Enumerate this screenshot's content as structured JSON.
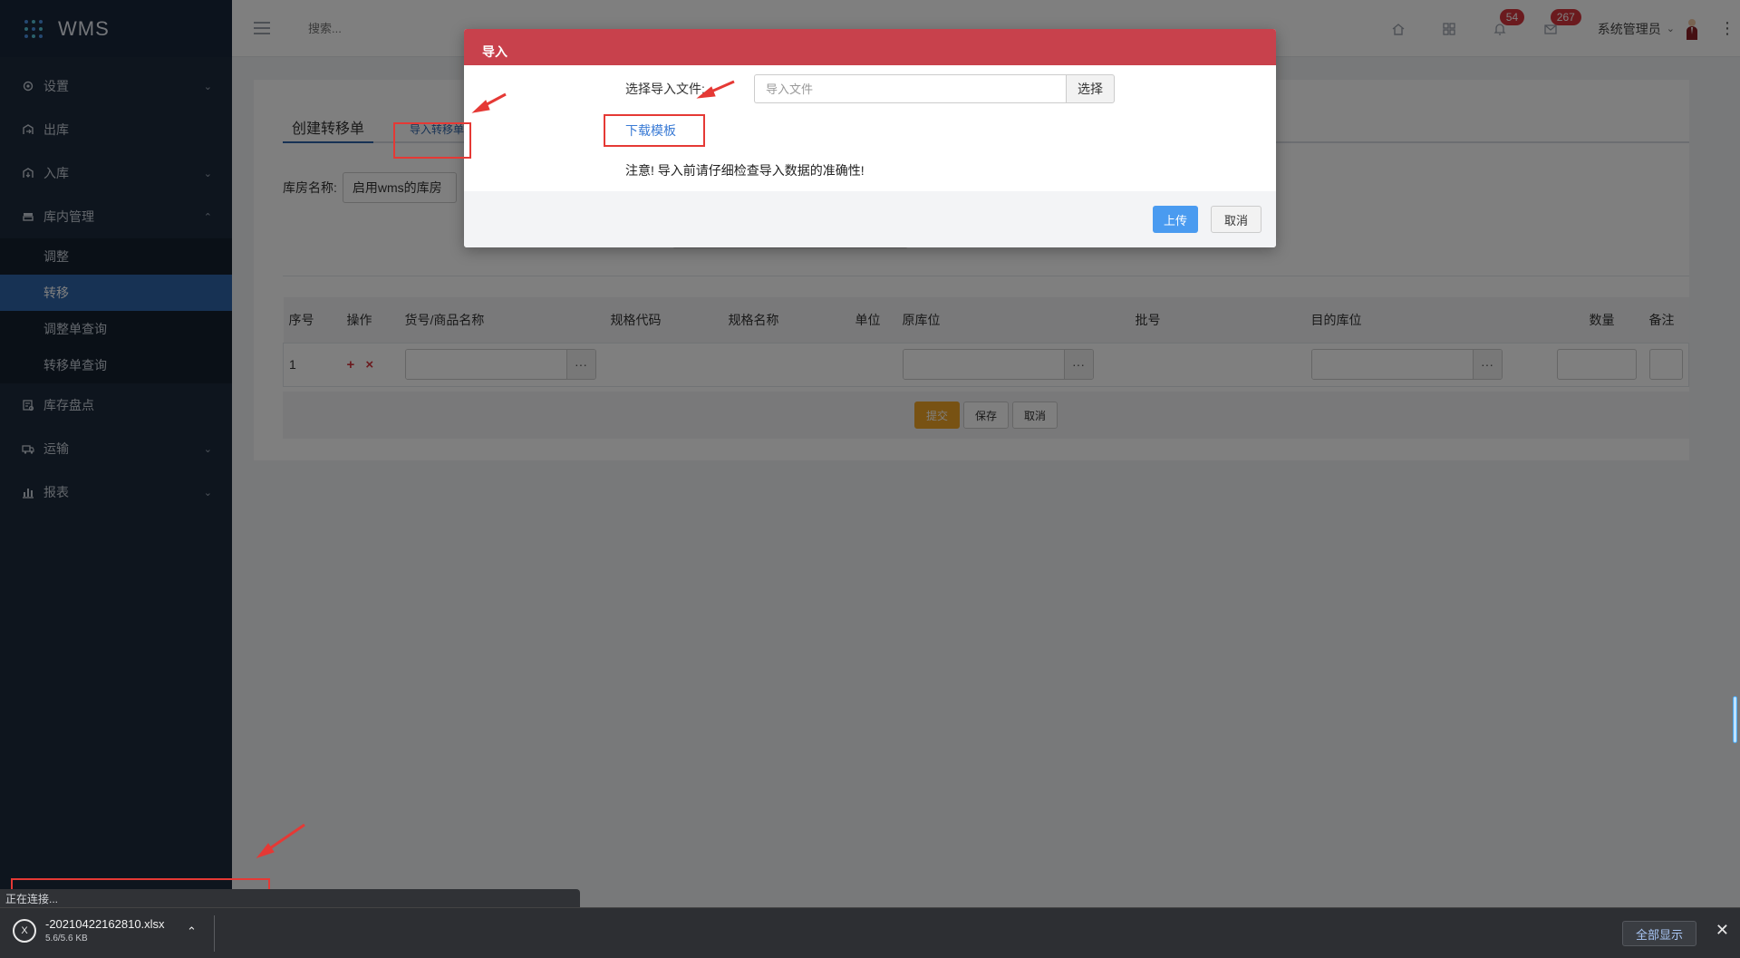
{
  "app": {
    "name": "WMS"
  },
  "sidebar": {
    "items": [
      {
        "label": "设置",
        "icon": "gear-icon",
        "chevron": "⌄"
      },
      {
        "label": "出库",
        "icon": "outbound-icon",
        "chevron": ""
      },
      {
        "label": "入库",
        "icon": "inbound-icon",
        "chevron": "⌄"
      },
      {
        "label": "库内管理",
        "icon": "warehouse-icon",
        "chevron": "⌃"
      }
    ],
    "subitems": [
      "调整",
      "转移",
      "调整单查询",
      "转移单查询"
    ],
    "active_subitem": "转移",
    "items_after": [
      {
        "label": "库存盘点",
        "icon": "inventory-icon",
        "chevron": ""
      },
      {
        "label": "运输",
        "icon": "truck-icon",
        "chevron": "⌄"
      },
      {
        "label": "报表",
        "icon": "chart-icon",
        "chevron": "⌄"
      }
    ]
  },
  "topbar": {
    "search_placeholder": "搜索...",
    "notifications_count": "54",
    "messages_count": "267",
    "user_name": "系统管理员"
  },
  "page": {
    "tab_create": "创建转移单",
    "tab_import": "导入转移单",
    "warehouse_label": "库房名称:",
    "warehouse_value": "启用wms的库房",
    "table": {
      "headers": [
        "序号",
        "操作",
        "货号/商品名称",
        "规格代码",
        "规格名称",
        "单位",
        "原库位",
        "批号",
        "目的库位",
        "数量",
        "备注"
      ],
      "row_index": "1",
      "row_ops": "+ ×"
    },
    "buttons": {
      "submit": "提交",
      "save": "保存",
      "cancel": "取消"
    }
  },
  "modal": {
    "title": "导入",
    "file_label": "选择导入文件:",
    "file_placeholder": "导入文件",
    "choose_button": "选择",
    "download_template": "下载模板",
    "notice": "注意! 导入前请仔细检查导入数据的准确性!",
    "upload_button": "上传",
    "cancel_button": "取消"
  },
  "browser": {
    "status_text": "正在连接...",
    "download": {
      "file_name": "-20210422162810.xlsx",
      "progress_text": "5.6/5.6 KB"
    },
    "show_all": "全部显示"
  }
}
